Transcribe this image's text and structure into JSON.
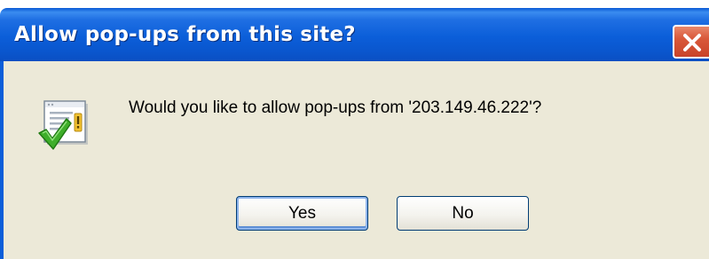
{
  "window": {
    "title": "Allow pop-ups from this site?",
    "close_icon": "close-icon"
  },
  "dialog": {
    "icon": "popup-allow-check-icon",
    "message": "Would you like to allow pop-ups from '203.149.46.222'?"
  },
  "buttons": {
    "yes_label": "Yes",
    "no_label": "No"
  },
  "colors": {
    "titlebar": "#0b5ed9",
    "dialog_background": "#ece9d8",
    "close_button": "#d9583a"
  }
}
